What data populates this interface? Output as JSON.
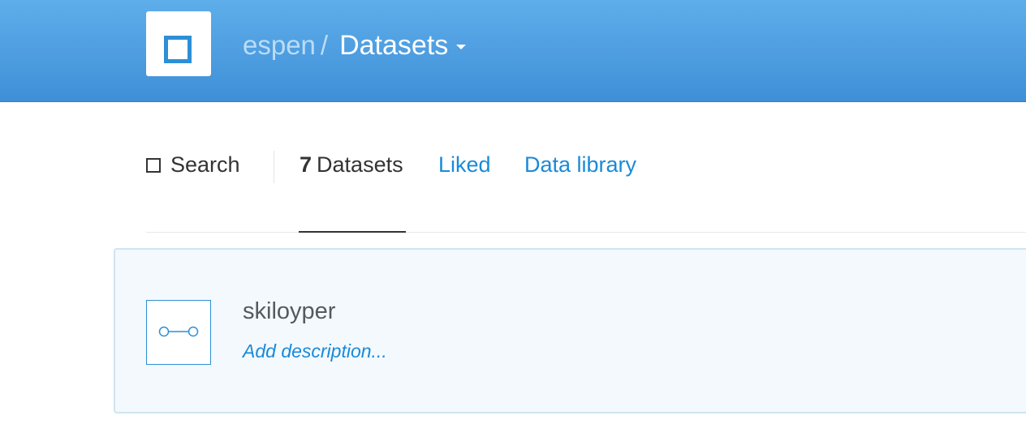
{
  "header": {
    "logo_icon": "square-logo-icon",
    "breadcrumb_user": "espen",
    "breadcrumb_separator": "/",
    "breadcrumb_current": "Datasets",
    "dropdown_icon": "caret-down-icon",
    "gradient_top": "#5eaeea",
    "gradient_bottom": "#3f8fd8"
  },
  "tabs": {
    "search_icon": "square-icon",
    "search_label": "Search",
    "datasets_count": "7",
    "datasets_label": "Datasets",
    "liked_label": "Liked",
    "library_label": "Data library",
    "link_color": "#1a8ad8"
  },
  "datasets": [
    {
      "icon": "dataset-connector-icon",
      "name": "skiloyper",
      "description_placeholder": "Add description..."
    }
  ]
}
